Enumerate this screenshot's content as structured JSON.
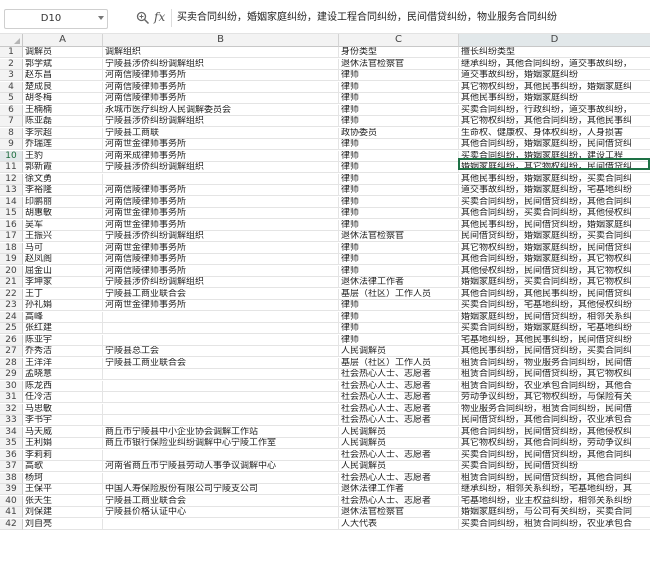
{
  "formula_bar": {
    "name_box": "D10",
    "fx_label": "fx",
    "formula": "买卖合同纠纷，婚姻家庭纠纷，建设工程合同纠纷，民间借贷纠纷，物业服务合同纠纷"
  },
  "columns": [
    "A",
    "B",
    "C",
    "D"
  ],
  "rows": [
    {
      "n": "1",
      "a": "调解员",
      "b": "调解组织",
      "c": "身份类型",
      "d": "擅长纠纷类型"
    },
    {
      "n": "2",
      "a": "郭学斌",
      "b": "宁陵县涉侨纠纷调解组织",
      "c": "退休法官检察官",
      "d": "继承纠纷，其他合同纠纷，道交事故纠纷，"
    },
    {
      "n": "3",
      "a": "赵东昌",
      "b": "河南信陵律师事务所",
      "c": "律师",
      "d": "道交事故纠纷，婚姻家庭纠纷"
    },
    {
      "n": "4",
      "a": "楚成良",
      "b": "河南信陵律师事务所",
      "c": "律师",
      "d": "其它物权纠纷，其他民事纠纷，婚姻家庭纠"
    },
    {
      "n": "5",
      "a": "胡冬梅",
      "b": "河南信陵律师事务所",
      "c": "律师",
      "d": "其他民事纠纷，婚姻家庭纠纷"
    },
    {
      "n": "6",
      "a": "王楠楠",
      "b": "永城市医疗纠纷人民调解委员会",
      "c": "律师",
      "d": "买卖合同纠纷，行政纠纷，道交事故纠纷，"
    },
    {
      "n": "7",
      "a": "陈亚磊",
      "b": "宁陵县涉侨纠纷调解组织",
      "c": "律师",
      "d": "其它物权纠纷，其他合同纠纷，其他民事纠"
    },
    {
      "n": "8",
      "a": "李宗超",
      "b": "宁陵县工商联",
      "c": "政协委员",
      "d": "生命权、健康权、身体权纠纷，人身损害"
    },
    {
      "n": "9",
      "a": "乔瑞莲",
      "b": "河南世金律师事务所",
      "c": "律师",
      "d": "其他合同纠纷，婚姻家庭纠纷，民间借贷纠"
    },
    {
      "n": "10",
      "a": "王豹",
      "b": "河南来成律师事务所",
      "c": "律师",
      "d": "买卖合同纠纷，婚姻家庭纠纷，建设工程"
    },
    {
      "n": "11",
      "a": "郭新霞",
      "b": "宁陵县涉侨纠纷调解组织",
      "c": "律师",
      "d": "婚姻家庭纠纷，其它物权纠纷，民间借贷纠"
    },
    {
      "n": "12",
      "a": "徐文勇",
      "b": "",
      "c": "律师",
      "d": "其他民事纠纷，婚姻家庭纠纷，买卖合同纠"
    },
    {
      "n": "13",
      "a": "李裕隆",
      "b": "河南信陵律师事务所",
      "c": "律师",
      "d": "道交事故纠纷，婚姻家庭纠纷，宅基地纠纷"
    },
    {
      "n": "14",
      "a": "印鹏丽",
      "b": "河南信陵律师事务所",
      "c": "律师",
      "d": "买卖合同纠纷，民间借贷纠纷，其他合同纠"
    },
    {
      "n": "15",
      "a": "胡惠敏",
      "b": "河南世金律师事务所",
      "c": "律师",
      "d": "其他合同纠纷，买卖合同纠纷，其他侵权纠"
    },
    {
      "n": "16",
      "a": "吴军",
      "b": "河南世金律师事务所",
      "c": "律师",
      "d": "其他民事纠纷，民间借贷纠纷，婚姻家庭纠"
    },
    {
      "n": "17",
      "a": "王振兴",
      "b": "宁陵县涉侨纠纷调解组织",
      "c": "退休法官检察官",
      "d": "民间借贷纠纷，婚姻家庭纠纷，买卖合同纠"
    },
    {
      "n": "18",
      "a": "马可",
      "b": "河南世金律师事务所",
      "c": "律师",
      "d": "其它物权纠纷，婚姻家庭纠纷，民间借贷纠"
    },
    {
      "n": "19",
      "a": "赵凤阁",
      "b": "河南信陵律师事务所",
      "c": "律师",
      "d": "其他合同纠纷，婚姻家庭纠纷，其它物权纠"
    },
    {
      "n": "20",
      "a": "屈金山",
      "b": "河南信陵律师事务所",
      "c": "律师",
      "d": "其他侵权纠纷，民间借贷纠纷，其它物权纠"
    },
    {
      "n": "21",
      "a": "李坤家",
      "b": "宁陵县涉侨纠纷调解组织",
      "c": "退休法律工作者",
      "d": "婚姻家庭纠纷，买卖合同纠纷，其它物权纠"
    },
    {
      "n": "22",
      "a": "王丁",
      "b": "宁陵县工商业联合会",
      "c": "基层（社区）工作人员",
      "d": "其他合同纠纷，其他民事纠纷，民间借贷纠"
    },
    {
      "n": "23",
      "a": "孙礼娟",
      "b": "河南世金律师事务所",
      "c": "律师",
      "d": "买卖合同纠纷，宅基地纠纷，其他侵权纠纷"
    },
    {
      "n": "24",
      "a": "高峰",
      "b": "",
      "c": "律师",
      "d": "婚姻家庭纠纷，民间借贷纠纷，相邻关系纠"
    },
    {
      "n": "25",
      "a": "张红建",
      "b": "",
      "c": "律师",
      "d": "买卖合同纠纷，婚姻家庭纠纷，宅基地纠纷"
    },
    {
      "n": "26",
      "a": "陈亚宇",
      "b": "",
      "c": "律师",
      "d": "宅基地纠纷，其他民事纠纷，民间借贷纠纷"
    },
    {
      "n": "27",
      "a": "乔秀洁",
      "b": "宁陵县总工会",
      "c": "人民调解员",
      "d": "其他民事纠纷，民间借贷纠纷，买卖合同纠"
    },
    {
      "n": "28",
      "a": "王洋洋",
      "b": "宁陵县工商业联合会",
      "c": "基层（社区）工作人员",
      "d": "租赁合同纠纷，物业服务合同纠纷，民间借"
    },
    {
      "n": "29",
      "a": "孟晓意",
      "b": "",
      "c": "社会热心人士、志愿者",
      "d": "租赁合同纠纷，民间借贷纠纷，其它物权纠"
    },
    {
      "n": "30",
      "a": "陈龙西",
      "b": "",
      "c": "社会热心人士、志愿者",
      "d": "租赁合同纠纷，农业承包合同纠纷，其他合"
    },
    {
      "n": "31",
      "a": "任冷洁",
      "b": "",
      "c": "社会热心人士、志愿者",
      "d": "劳动争议纠纷，其它物权纠纷，与保险有关"
    },
    {
      "n": "32",
      "a": "马思敏",
      "b": "",
      "c": "社会热心人士、志愿者",
      "d": "物业服务合同纠纷，租赁合同纠纷，民间借"
    },
    {
      "n": "33",
      "a": "李书宇",
      "b": "",
      "c": "社会热心人士、志愿者",
      "d": "民间借贷纠纷，其他合同纠纷，农业承包合"
    },
    {
      "n": "34",
      "a": "马天威",
      "b": "商丘市宁陵县中小企业协会调解工作站",
      "c": "人民调解员",
      "d": "其他合同纠纷，民间借贷纠纷，其他侵权纠"
    },
    {
      "n": "35",
      "a": "王利娟",
      "b": "商丘市银行保险业纠纷调解中心宁陵工作室",
      "c": "人民调解员",
      "d": "其它物权纠纷，其他合同纠纷，劳动争议纠"
    },
    {
      "n": "36",
      "a": "李莉莉",
      "b": "",
      "c": "社会热心人士、志愿者",
      "d": "买卖合同纠纷，民间借贷纠纷，其他合同纠"
    },
    {
      "n": "37",
      "a": "高歌",
      "b": "河南省商丘市宁陵县劳动人事争议调解中心",
      "c": "人民调解员",
      "d": "买卖合同纠纷，民间借贷纠纷"
    },
    {
      "n": "38",
      "a": "杨珂",
      "b": "",
      "c": "社会热心人士、志愿者",
      "d": "租赁合同纠纷，民间借贷纠纷，其他合同纠"
    },
    {
      "n": "39",
      "a": "王保平",
      "b": "中国人寿保险股份有限公司宁陵支公司",
      "c": "退休法律工作者",
      "d": "继承纠纷，相邻关系纠纷，宅基地纠纷，其"
    },
    {
      "n": "40",
      "a": "张天生",
      "b": "宁陵县工商业联合会",
      "c": "社会热心人士、志愿者",
      "d": "宅基地纠纷，业主权益纠纷，相邻关系纠纷"
    },
    {
      "n": "41",
      "a": "刘保建",
      "b": "宁陵县价格认证中心",
      "c": "退休法官检察官",
      "d": "婚姻家庭纠纷，与公司有关纠纷，买卖合同"
    },
    {
      "n": "42",
      "a": "刘自亮",
      "b": "",
      "c": "人大代表",
      "d": "买卖合同纠纷，租赁合同纠纷，农业承包合"
    }
  ]
}
